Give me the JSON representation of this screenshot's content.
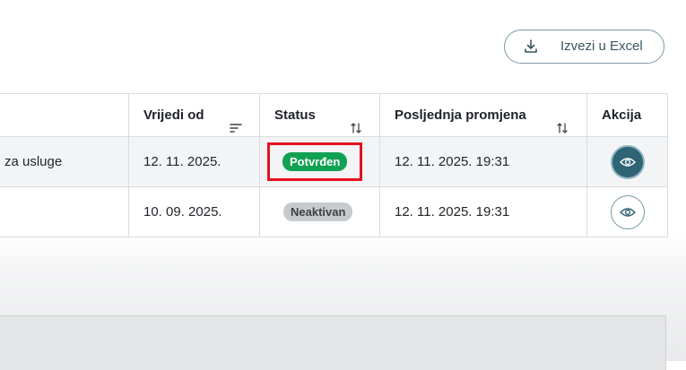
{
  "toolbar": {
    "export_label": "Izvezi u Excel"
  },
  "table": {
    "headers": {
      "name": "",
      "valid_from": "Vrijedi od",
      "status": "Status",
      "last_change": "Posljednja promjena",
      "action": "Akcija"
    },
    "rows": [
      {
        "name": "za usluge",
        "valid_from": "12. 11. 2025.",
        "status": "Potvrđen",
        "last_change": "12. 11. 2025. 19:31"
      },
      {
        "name": "",
        "valid_from": "10. 09. 2025.",
        "status": "Neaktivan",
        "last_change": "12. 11. 2025. 19:31"
      }
    ]
  },
  "icons": {
    "export": "download-icon",
    "sort_valid_from": "sort-lines-icon",
    "sort_status": "sort-arrows-icon",
    "sort_last_change": "sort-arrows-icon",
    "view": "eye-icon"
  },
  "colors": {
    "accent": "#2e6474",
    "confirmed": "#11a152",
    "inactive": "#c7cacd",
    "highlight": "#e5131c"
  }
}
